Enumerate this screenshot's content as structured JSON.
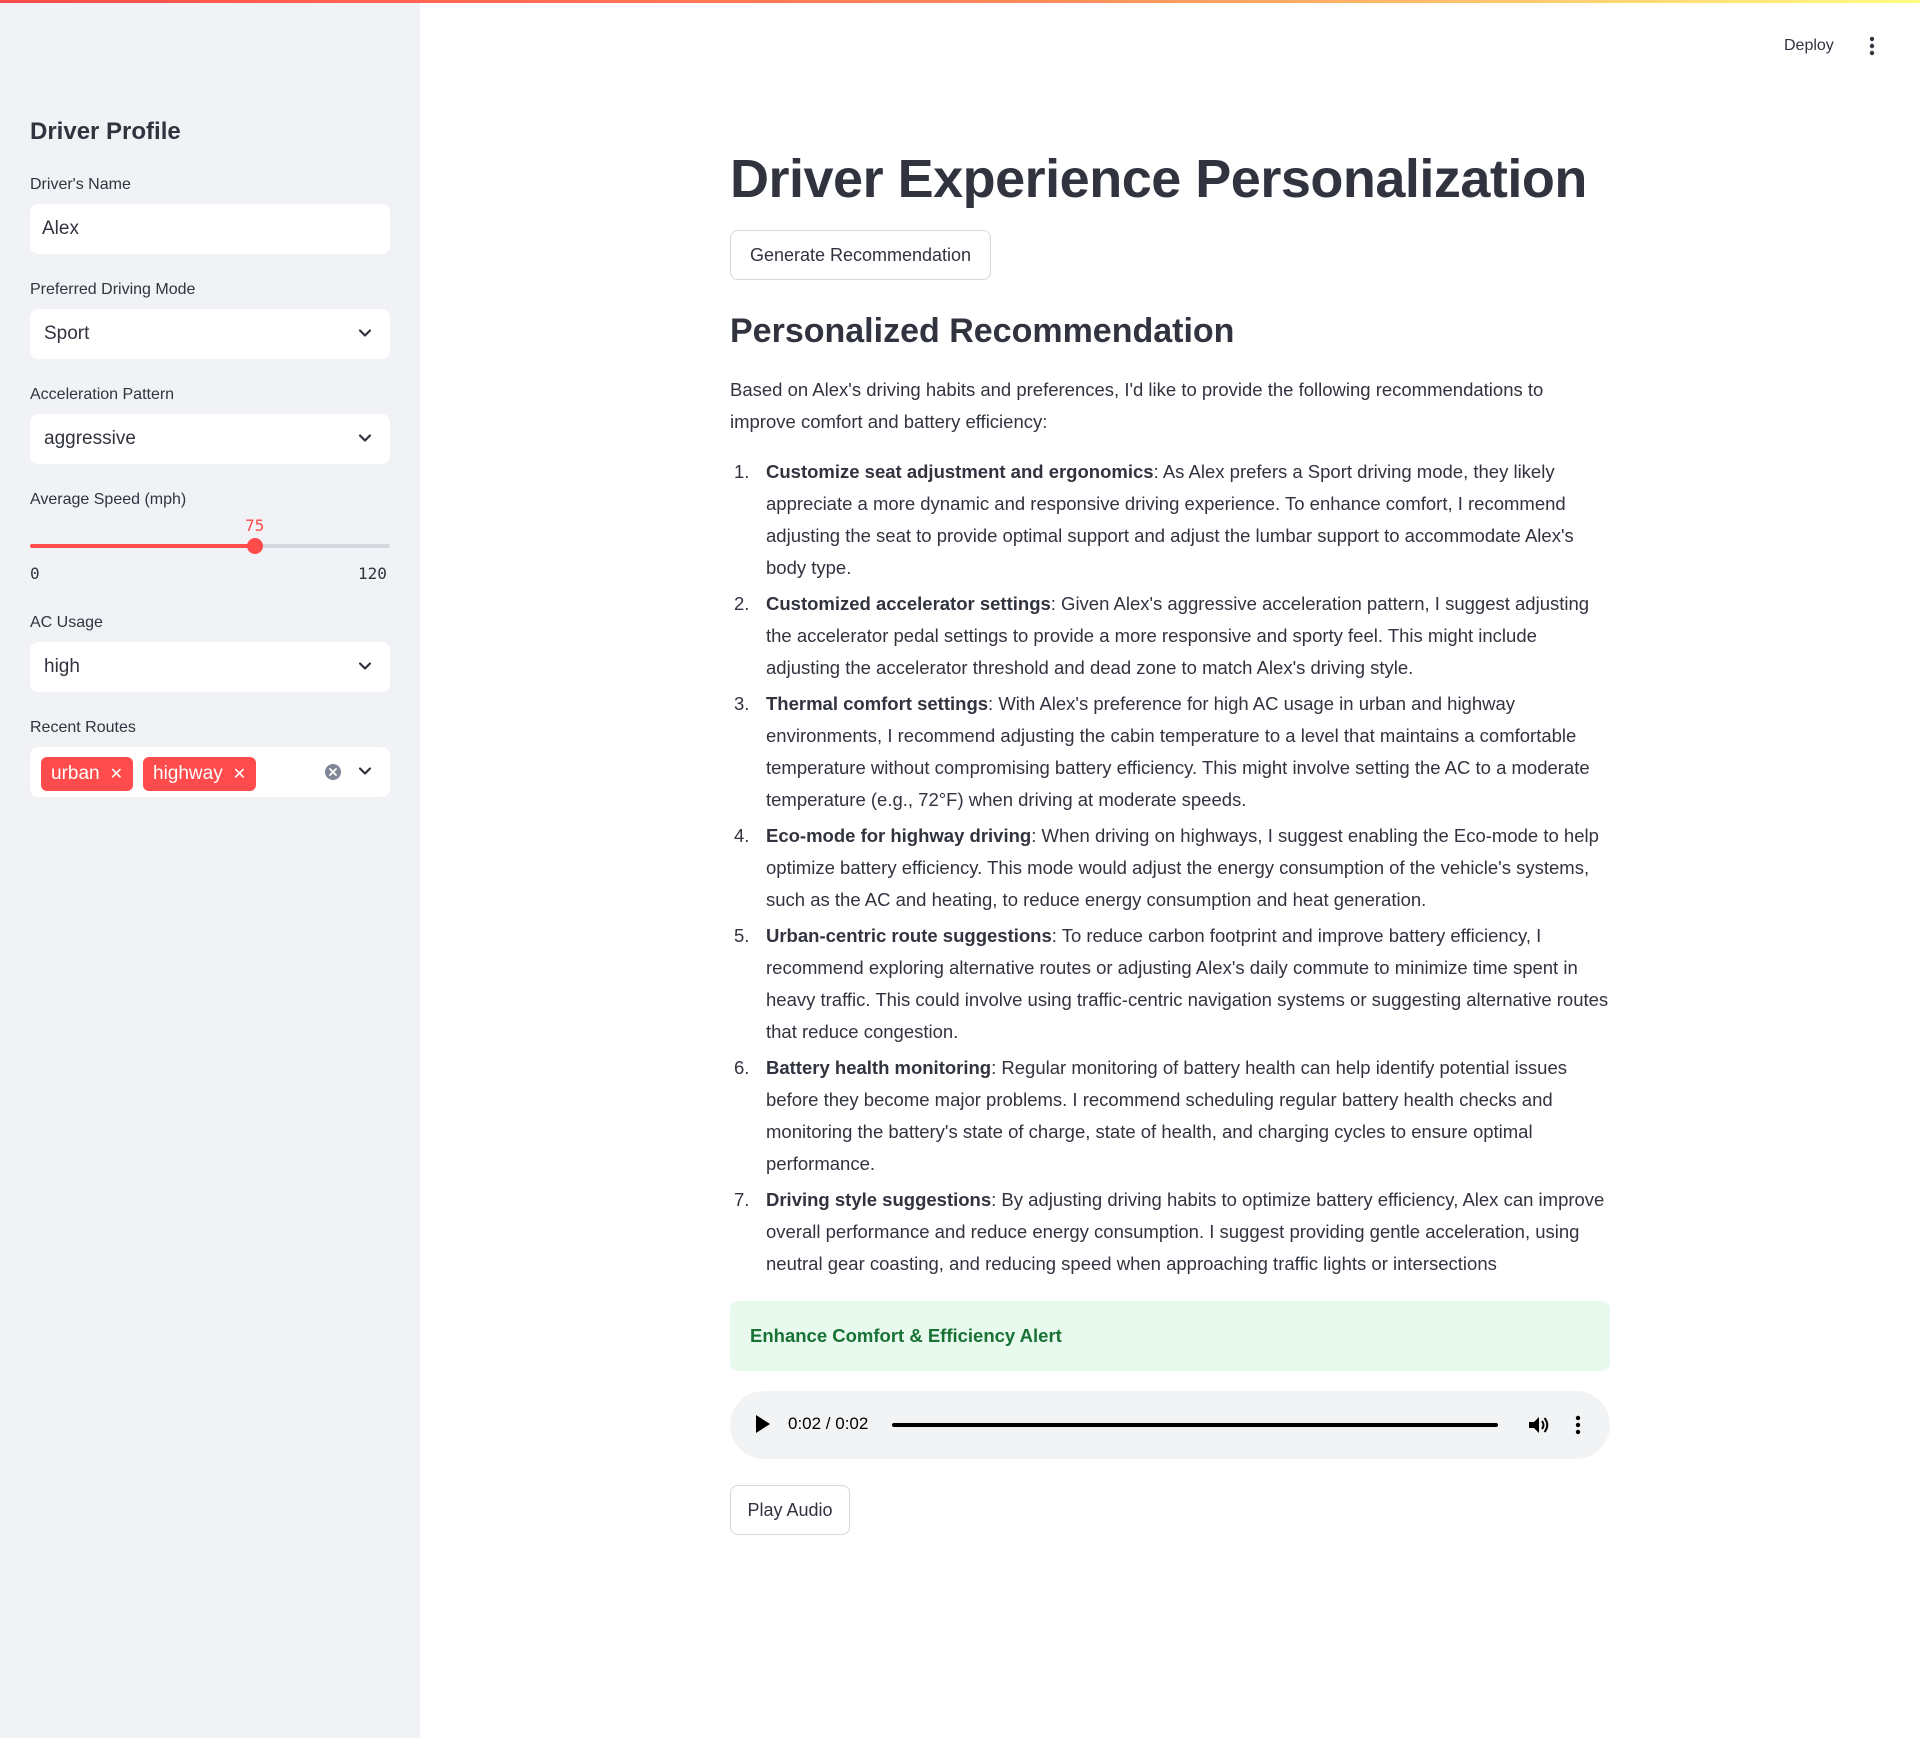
{
  "header": {
    "deploy_label": "Deploy"
  },
  "sidebar": {
    "title": "Driver Profile",
    "name_label": "Driver's Name",
    "name_value": "Alex",
    "mode_label": "Preferred Driving Mode",
    "mode_value": "Sport",
    "accel_label": "Acceleration Pattern",
    "accel_value": "aggressive",
    "speed_label": "Average Speed (mph)",
    "speed_value": "75",
    "speed_min": "0",
    "speed_max": "120",
    "speed_fraction": 0.625,
    "ac_label": "AC Usage",
    "ac_value": "high",
    "routes_label": "Recent Routes",
    "routes": [
      "urban",
      "highway"
    ]
  },
  "main": {
    "title": "Driver Experience Personalization",
    "generate_button": "Generate Recommendation",
    "section_title": "Personalized Recommendation",
    "intro": "Based on Alex's driving habits and preferences, I'd like to provide the following recommendations to improve comfort and battery efficiency:",
    "recommendations": [
      {
        "num": "1.",
        "title": "Customize seat adjustment and ergonomics",
        "text": ": As Alex prefers a Sport driving mode, they likely appreciate a more dynamic and responsive driving experience. To enhance comfort, I recommend adjusting the seat to provide optimal support and adjust the lumbar support to accommodate Alex's body type."
      },
      {
        "num": "2.",
        "title": "Customized accelerator settings",
        "text": ": Given Alex's aggressive acceleration pattern, I suggest adjusting the accelerator pedal settings to provide a more responsive and sporty feel. This might include adjusting the accelerator threshold and dead zone to match Alex's driving style."
      },
      {
        "num": "3.",
        "title": "Thermal comfort settings",
        "text": ": With Alex's preference for high AC usage in urban and highway environments, I recommend adjusting the cabin temperature to a level that maintains a comfortable temperature without compromising battery efficiency. This might involve setting the AC to a moderate temperature (e.g., 72°F) when driving at moderate speeds."
      },
      {
        "num": "4.",
        "title": "Eco-mode for highway driving",
        "text": ": When driving on highways, I suggest enabling the Eco-mode to help optimize battery efficiency. This mode would adjust the energy consumption of the vehicle's systems, such as the AC and heating, to reduce energy consumption and heat generation."
      },
      {
        "num": "5.",
        "title": "Urban-centric route suggestions",
        "text": ": To reduce carbon footprint and improve battery efficiency, I recommend exploring alternative routes or adjusting Alex's daily commute to minimize time spent in heavy traffic. This could involve using traffic-centric navigation systems or suggesting alternative routes that reduce congestion."
      },
      {
        "num": "6.",
        "title": "Battery health monitoring",
        "text": ": Regular monitoring of battery health can help identify potential issues before they become major problems. I recommend scheduling regular battery health checks and monitoring the battery's state of charge, state of health, and charging cycles to ensure optimal performance."
      },
      {
        "num": "7.",
        "title": "Driving style suggestions",
        "text": ": By adjusting driving habits to optimize battery efficiency, Alex can improve overall performance and reduce energy consumption. I suggest providing gentle acceleration, using neutral gear coasting, and reducing speed when approaching traffic lights or intersections"
      }
    ],
    "alert_text": "Enhance Comfort & Efficiency Alert",
    "audio_time": "0:02 / 0:02",
    "audio_progress": 1.0,
    "play_audio_button": "Play Audio"
  },
  "colors": {
    "accent": "#ff4b4b",
    "sidebar_bg": "#f0f2f6",
    "alert_bg": "#e8f9ee",
    "alert_text": "#177233"
  },
  "icons": [
    "chevron-down-icon",
    "clear-icon",
    "close-icon",
    "kebab-menu-icon",
    "play-icon",
    "volume-icon"
  ]
}
